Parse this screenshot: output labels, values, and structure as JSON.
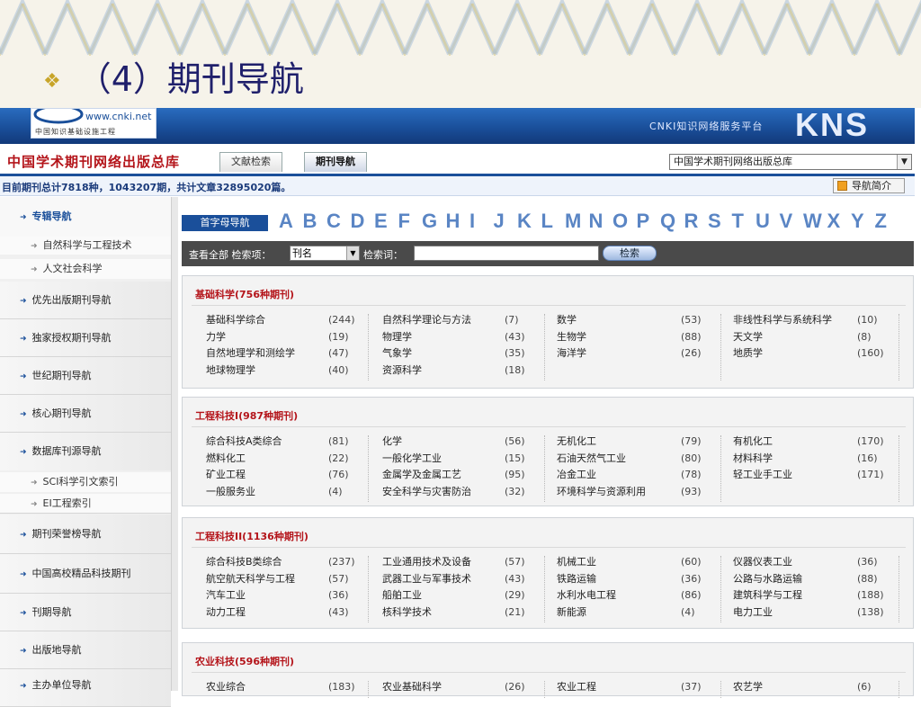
{
  "slide": {
    "bullet": "❖",
    "title": "（4）期刊导航"
  },
  "banner": {
    "logo_text": "www.cnki.net",
    "logo_sub": "中国知识基础设施工程",
    "slogan": "CNKI知识网络服务平台",
    "kns": "KNS"
  },
  "db": {
    "title": "中国学术期刊网络出版总库",
    "tabs": [
      "文献检索",
      "期刊导航"
    ],
    "select_value": "中国学术期刊网络出版总库"
  },
  "stats": {
    "text": "目前期刊总计7818种，1043207期，共计文章32895020篇。",
    "guide_label": "导航简介"
  },
  "sidebar": {
    "items": [
      {
        "label": "专辑导航",
        "head": true
      },
      {
        "label": "自然科学与工程技术",
        "sub": true
      },
      {
        "label": "人文社会科学",
        "sub": true
      },
      {
        "label": "优先出版期刊导航"
      },
      {
        "label": "独家授权期刊导航"
      },
      {
        "label": "世纪期刊导航"
      },
      {
        "label": "核心期刊导航"
      },
      {
        "label": "数据库刊源导航"
      },
      {
        "label": "SCI科学引文索引",
        "sub": true
      },
      {
        "label": "EI工程索引",
        "sub": true
      },
      {
        "label": "期刊荣誉榜导航"
      },
      {
        "label": "中国高校精品科技期刊"
      },
      {
        "label": "刊期导航"
      },
      {
        "label": "出版地导航"
      },
      {
        "label": "主办单位导航"
      }
    ]
  },
  "letter_nav": {
    "label": "首字母导航",
    "letters": [
      "A",
      "B",
      "C",
      "D",
      "E",
      "F",
      "G",
      "H",
      "I",
      "J",
      "K",
      "L",
      "M",
      "N",
      "O",
      "P",
      "Q",
      "R",
      "S",
      "T",
      "U",
      "V",
      "W",
      "X",
      "Y",
      "Z"
    ]
  },
  "search": {
    "view_all": "查看全部 检索项：",
    "field_value": "刊名",
    "keyword_label": "检索词：",
    "button": "检索"
  },
  "categories": [
    {
      "title": "基础科学(756种期刊)",
      "rows": [
        [
          [
            "基础科学综合",
            "(244)"
          ],
          [
            "自然科学理论与方法",
            "(7)"
          ],
          [
            "数学",
            "(53)"
          ],
          [
            "非线性科学与系统科学",
            "(10)"
          ]
        ],
        [
          [
            "力学",
            "(19)"
          ],
          [
            "物理学",
            "(43)"
          ],
          [
            "生物学",
            "(88)"
          ],
          [
            "天文学",
            "(8)"
          ]
        ],
        [
          [
            "自然地理学和测绘学",
            "(47)"
          ],
          [
            "气象学",
            "(35)"
          ],
          [
            "海洋学",
            "(26)"
          ],
          [
            "地质学",
            "(160)"
          ]
        ],
        [
          [
            "地球物理学",
            "(40)"
          ],
          [
            "资源科学",
            "(18)"
          ]
        ]
      ]
    },
    {
      "title": "工程科技I(987种期刊)",
      "rows": [
        [
          [
            "综合科技A类综合",
            "(81)"
          ],
          [
            "化学",
            "(56)"
          ],
          [
            "无机化工",
            "(79)"
          ],
          [
            "有机化工",
            "(170)"
          ]
        ],
        [
          [
            "燃料化工",
            "(22)"
          ],
          [
            "一般化学工业",
            "(15)"
          ],
          [
            "石油天然气工业",
            "(80)"
          ],
          [
            "材料科学",
            "(16)"
          ]
        ],
        [
          [
            "矿业工程",
            "(76)"
          ],
          [
            "金属学及金属工艺",
            "(95)"
          ],
          [
            "冶金工业",
            "(78)"
          ],
          [
            "轻工业手工业",
            "(171)"
          ]
        ],
        [
          [
            "一般服务业",
            "(4)"
          ],
          [
            "安全科学与灾害防治",
            "(32)"
          ],
          [
            "环境科学与资源利用",
            "(93)"
          ]
        ]
      ]
    },
    {
      "title": "工程科技II(1136种期刊)",
      "rows": [
        [
          [
            "综合科技B类综合",
            "(237)"
          ],
          [
            "工业通用技术及设备",
            "(57)"
          ],
          [
            "机械工业",
            "(60)"
          ],
          [
            "仪器仪表工业",
            "(36)"
          ]
        ],
        [
          [
            "航空航天科学与工程",
            "(57)"
          ],
          [
            "武器工业与军事技术",
            "(43)"
          ],
          [
            "铁路运输",
            "(36)"
          ],
          [
            "公路与水路运输",
            "(88)"
          ]
        ],
        [
          [
            "汽车工业",
            "(36)"
          ],
          [
            "船舶工业",
            "(29)"
          ],
          [
            "水利水电工程",
            "(86)"
          ],
          [
            "建筑科学与工程",
            "(188)"
          ]
        ],
        [
          [
            "动力工程",
            "(43)"
          ],
          [
            "核科学技术",
            "(21)"
          ],
          [
            "新能源",
            "(4)"
          ],
          [
            "电力工业",
            "(138)"
          ]
        ]
      ]
    },
    {
      "title": "农业科技(596种期刊)",
      "rows": [
        [
          [
            "农业综合",
            "(183)"
          ],
          [
            "农业基础科学",
            "(26)"
          ],
          [
            "农业工程",
            "(37)"
          ],
          [
            "农艺学",
            "(6)"
          ]
        ]
      ]
    }
  ],
  "colors": {
    "accent": "#1a4f9a",
    "category_title": "#b4141a",
    "slide_title": "#1f1f6b"
  }
}
